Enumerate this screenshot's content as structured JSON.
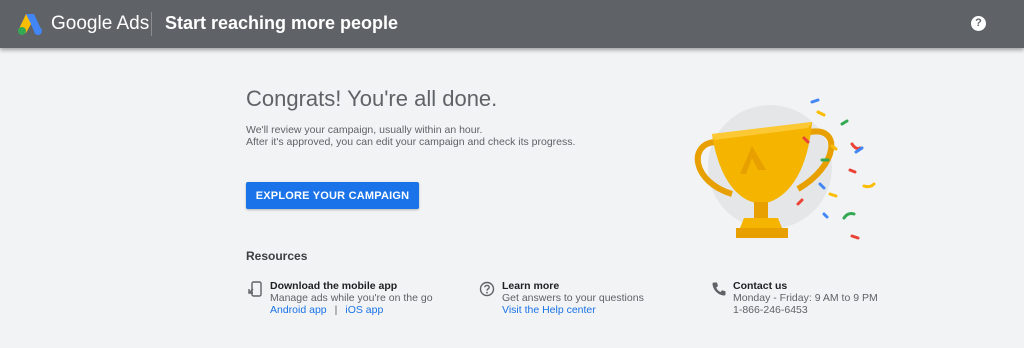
{
  "header": {
    "brand": "Google Ads",
    "title": "Start reaching more people",
    "help_glyph": "?"
  },
  "main": {
    "headline": "Congrats! You're all done.",
    "description_line1": "We'll review your campaign, usually within an hour.",
    "description_line2": "After it's approved, you can edit your campaign and check its progress.",
    "explore_button": "EXPLORE YOUR CAMPAIGN"
  },
  "resources": {
    "title": "Resources",
    "items": [
      {
        "icon": "mobile-download-icon",
        "heading": "Download the mobile app",
        "text": "Manage ads while you're on the go",
        "link1": "Android app",
        "separator": "|",
        "link2": "iOS app"
      },
      {
        "icon": "help-circle-icon",
        "heading": "Learn more",
        "text": "Get answers to your questions",
        "link1": "Visit the Help center"
      },
      {
        "icon": "phone-icon",
        "heading": "Contact us",
        "text": "Monday - Friday: 9 AM to 9 PM",
        "text2": "1-866-246-6453"
      }
    ]
  },
  "colors": {
    "topbar": "#5f6368",
    "background": "#f1f3f4",
    "primary_button": "#1a73e8",
    "link": "#1a73e8",
    "trophy": "#f4b400"
  }
}
